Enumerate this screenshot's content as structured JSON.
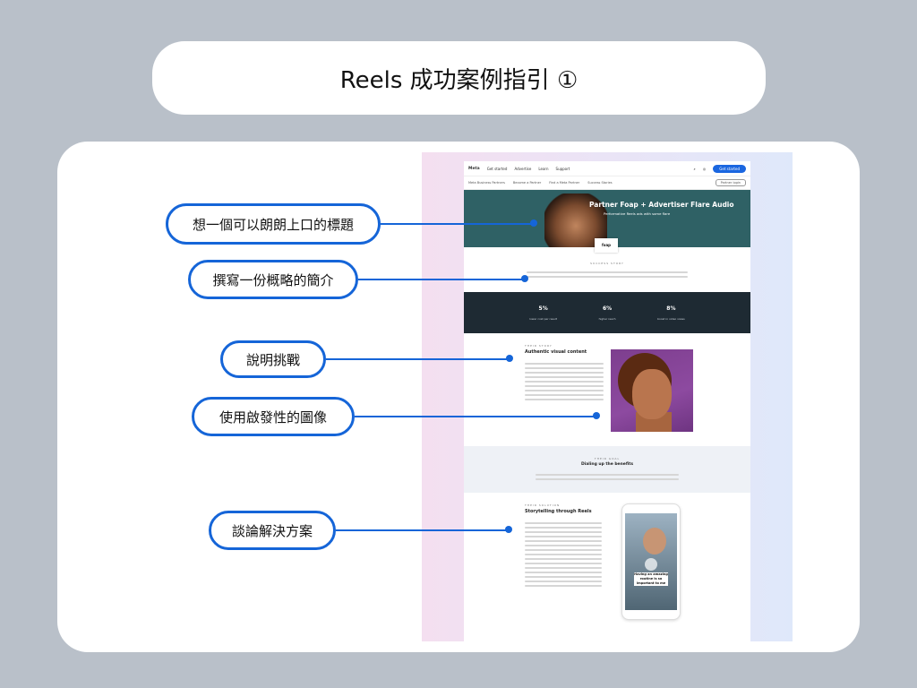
{
  "title": "Reels 成功案例指引 ①",
  "callouts": [
    "想一個可以朗朗上口的標題",
    "撰寫一份概略的簡介",
    "說明挑戰",
    "使用啟發性的圖像",
    "談論解決方案"
  ],
  "mock_page": {
    "nav": {
      "logo": "Meta",
      "links": [
        "Get started",
        "Advertise",
        "Learn",
        "Support"
      ],
      "cta": "Get started"
    },
    "subnav": {
      "brand": "Meta Business Partners",
      "links": [
        "Become a Partner",
        "Find a Meta Partner",
        "Success Stories"
      ],
      "button": "Partner login"
    },
    "hero": {
      "title": "Partner Foap + Advertiser Flare Audio",
      "subtitle": "Performative Reels ads with some flare",
      "badge": "foap"
    },
    "story_label": "SUCCESS STORY",
    "stats": [
      {
        "value": "5%",
        "desc": "lower cost per result"
      },
      {
        "value": "6%",
        "desc": "higher reach"
      },
      {
        "value": "8%",
        "desc": "boost in video views"
      }
    ],
    "challenge": {
      "label": "THEIR STORY",
      "heading": "Authentic visual content"
    },
    "goal": {
      "label": "THEIR GOAL",
      "heading": "Dialing up the benefits"
    },
    "solution": {
      "label": "THEIR SOLUTION",
      "heading": "Storytelling through Reels",
      "caption": "Having an amazing routine is so important to me"
    }
  }
}
